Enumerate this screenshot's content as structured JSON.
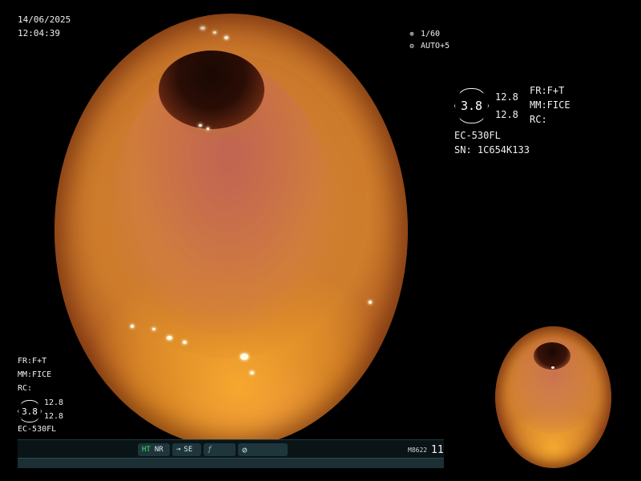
{
  "colors": {
    "background": "#000000",
    "text": "#f0f0f0",
    "status_bar_bg": "#0a1417",
    "status_highlight": "#2ee86a",
    "mucosa_orange": "#e49a3e"
  },
  "header": {
    "date": "14/06/2025",
    "time": "12:04:39"
  },
  "exposure": {
    "shutter_icon": "shutter-icon",
    "shutter_value": "1/60",
    "auto_icon": "auto-iris-icon",
    "auto_value": "AUTO+5"
  },
  "right_panel": {
    "badge_value": "3.8",
    "value_top": "12.8",
    "value_bottom": "12.8",
    "fr": "FR:F+T",
    "mm": "MM:FICE",
    "rc": "RC:",
    "scope_model": "EC-530FL",
    "serial": "SN: 1C654K133"
  },
  "left_panel": {
    "fr": "FR:F+T",
    "mm": "MM:FICE",
    "rc": "RC:",
    "badge_value": "3.8",
    "value_top": "12.8",
    "value_bottom": "12.8",
    "scope_model": "EC-530FL"
  },
  "status_bar": {
    "ht_label": "HT",
    "nr_label": "NR",
    "se_icon": "se-scope-icon",
    "se_label": "SE",
    "function_icon": "function-icon",
    "mode_icon": "mode-circle-icon",
    "code": "M8622",
    "frame_number": "11"
  },
  "views": {
    "main_view": "endoscopic-main-view",
    "pip_view": "endoscopic-pip-view"
  }
}
